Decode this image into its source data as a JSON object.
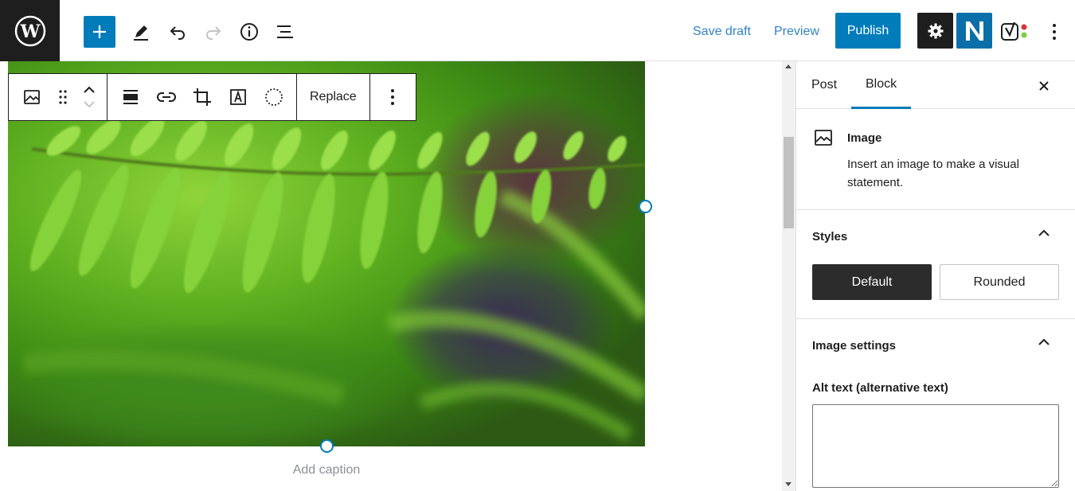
{
  "header": {
    "save_draft_label": "Save draft",
    "preview_label": "Preview",
    "publish_label": "Publish",
    "accent_color": "#007cba",
    "icons": [
      "wordpress-logo",
      "add-icon",
      "pencil-icon",
      "undo-icon",
      "redo-icon",
      "info-icon",
      "list-view-icon",
      "gear-icon",
      "n-plugin-icon",
      "yoast-icon",
      "more-vertical-icon"
    ]
  },
  "block_toolbar": {
    "replace_label": "Replace",
    "icons": [
      "image-icon",
      "drag-handle-icon",
      "move-up-down-icon",
      "align-icon",
      "link-icon",
      "crop-icon",
      "text-overlay-icon",
      "duotone-icon",
      "more-vertical-icon"
    ]
  },
  "canvas": {
    "caption_placeholder": "Add caption"
  },
  "sidebar": {
    "tabs": [
      {
        "label": "Post",
        "active": false
      },
      {
        "label": "Block",
        "active": true
      }
    ],
    "block": {
      "title": "Image",
      "description": "Insert an image to make a visual statement."
    },
    "styles": {
      "title": "Styles",
      "options": [
        {
          "label": "Default",
          "selected": true
        },
        {
          "label": "Rounded",
          "selected": false
        }
      ]
    },
    "image_settings": {
      "title": "Image settings",
      "alt_label": "Alt text (alternative text)",
      "alt_value": ""
    }
  }
}
